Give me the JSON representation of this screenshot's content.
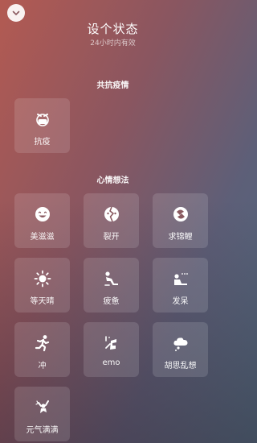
{
  "header": {
    "title": "设个状态",
    "subtitle": "24小时内有效"
  },
  "sections": [
    {
      "title": "共抗疫情",
      "items": [
        {
          "label": "抗疫",
          "icon": "mask-face-icon"
        }
      ]
    },
    {
      "title": "心情想法",
      "items": [
        {
          "label": "美滋滋",
          "icon": "smile-icon"
        },
        {
          "label": "裂开",
          "icon": "cracked-face-icon"
        },
        {
          "label": "求锦鲤",
          "icon": "koi-icon"
        },
        {
          "label": "等天晴",
          "icon": "sun-icon"
        },
        {
          "label": "疲惫",
          "icon": "tired-person-icon"
        },
        {
          "label": "发呆",
          "icon": "daydream-icon"
        },
        {
          "label": "冲",
          "icon": "running-icon"
        },
        {
          "label": "emo",
          "icon": "emo-icon"
        },
        {
          "label": "胡思乱想",
          "icon": "thought-cloud-icon"
        },
        {
          "label": "元气满满",
          "icon": "energetic-icon"
        }
      ]
    }
  ]
}
